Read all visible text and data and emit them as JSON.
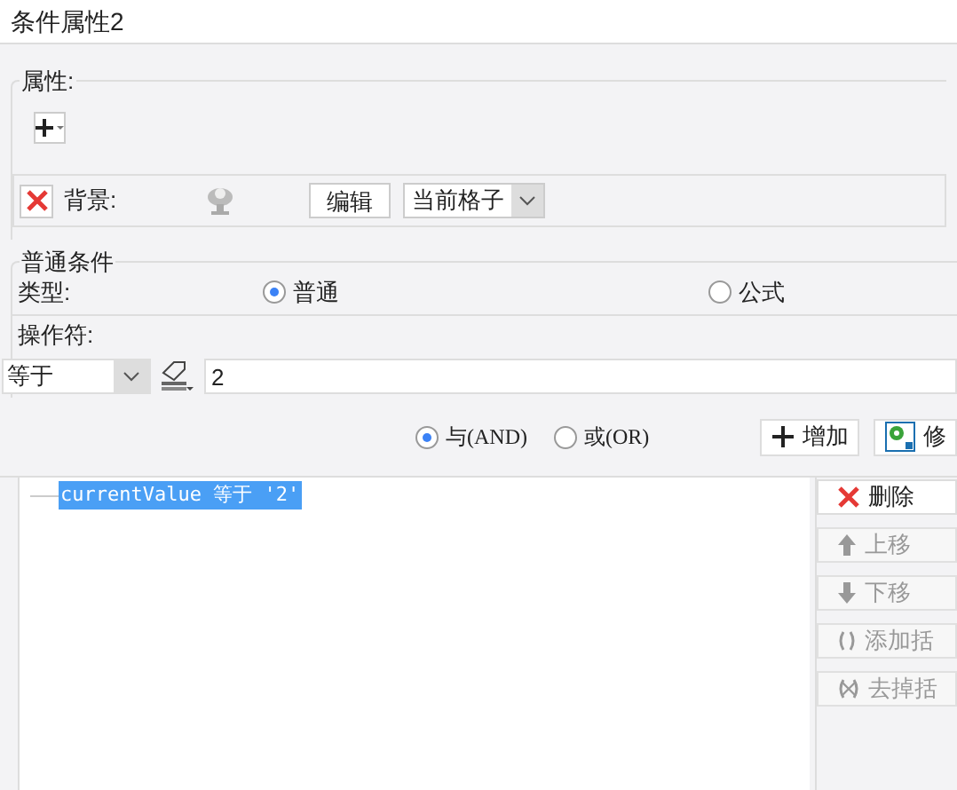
{
  "window": {
    "title": "条件属性2"
  },
  "properties": {
    "legend": "属性:",
    "row": {
      "checked": true,
      "label": "背景:",
      "edit_button": "编辑",
      "scope": "当前格子"
    }
  },
  "condition": {
    "legend": "普通条件",
    "type_label": "类型:",
    "types": [
      {
        "label": "普通",
        "selected": true
      },
      {
        "label": "公式",
        "selected": false
      }
    ],
    "operator_label": "操作符:",
    "operator": "等于",
    "value": "2"
  },
  "join": [
    {
      "label": "与(AND)",
      "selected": true
    },
    {
      "label": "或(OR)",
      "selected": false
    }
  ],
  "buttons": [
    {
      "label": "增加"
    },
    {
      "label": "修"
    }
  ],
  "conditions": [
    {
      "text": "currentValue 等于 '2'",
      "selected": true
    }
  ],
  "side_buttons": [
    {
      "label": "删除",
      "disabled": false
    },
    {
      "label": "上移",
      "disabled": true
    },
    {
      "label": "下移",
      "disabled": true
    },
    {
      "label": "添加括",
      "disabled": true
    },
    {
      "label": "去掉括",
      "disabled": true
    }
  ]
}
